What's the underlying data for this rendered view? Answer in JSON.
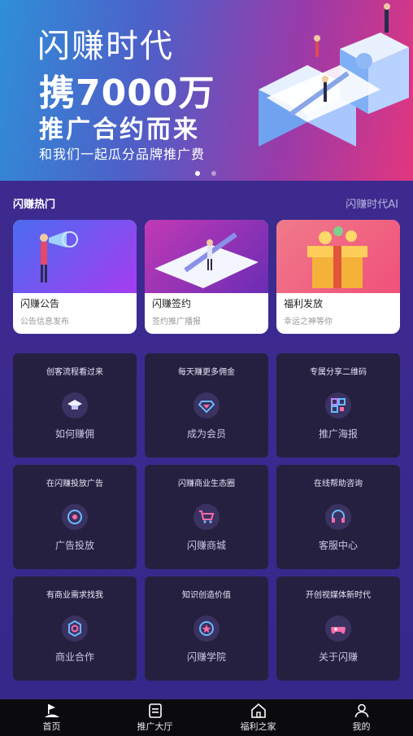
{
  "banner": {
    "title": "闪赚时代",
    "line1_prefix": "携",
    "line1_number": "7000",
    "line1_suffix": "万",
    "line2": "推广合约而来",
    "line3": "和我们一起瓜分品牌推广费",
    "dots": 2,
    "active_dot": 0
  },
  "section": {
    "title": "闪赚热门",
    "right": "闪赚时代AI"
  },
  "cards": [
    {
      "title": "闪赚公告",
      "subtitle": "公告信息发布",
      "icon": "megaphone-illustration"
    },
    {
      "title": "闪赚签约",
      "subtitle": "签约推广播报",
      "icon": "contract-pen-illustration"
    },
    {
      "title": "福利发放",
      "subtitle": "幸运之神等你",
      "icon": "gift-box-illustration"
    }
  ],
  "tiles": [
    {
      "caption": "创客流程看过来",
      "label": "如何赚佣",
      "icon": "graduation-cap-icon"
    },
    {
      "caption": "每天赚更多佣金",
      "label": "成为会员",
      "icon": "diamond-icon"
    },
    {
      "caption": "专属分享二维码",
      "label": "推广海报",
      "icon": "qr-code-icon"
    },
    {
      "caption": "在闪赚投放广告",
      "label": "广告投放",
      "icon": "target-icon"
    },
    {
      "caption": "闪赚商业生态圈",
      "label": "闪赚商城",
      "icon": "cart-icon"
    },
    {
      "caption": "在线帮助咨询",
      "label": "客服中心",
      "icon": "headset-icon"
    },
    {
      "caption": "有商业需求找我",
      "label": "商业合作",
      "icon": "gear-icon"
    },
    {
      "caption": "知识创造价值",
      "label": "闪赚学院",
      "icon": "star-badge-icon"
    },
    {
      "caption": "开创视媒体新时代",
      "label": "关于闪赚",
      "icon": "gamepad-icon"
    }
  ],
  "tabbar": [
    {
      "label": "首页",
      "icon": "home-flag-icon",
      "active": true
    },
    {
      "label": "推广大厅",
      "icon": "document-icon",
      "active": false
    },
    {
      "label": "福利之家",
      "icon": "house-icon",
      "active": false
    },
    {
      "label": "我的",
      "icon": "user-icon",
      "active": false
    }
  ],
  "colors": {
    "banner_start": "#2f8fd8",
    "banner_end": "#e2367e",
    "page_bg": "#3a2a8a",
    "tile_bg": "#262040",
    "tabbar_bg": "#0b0b0e"
  }
}
